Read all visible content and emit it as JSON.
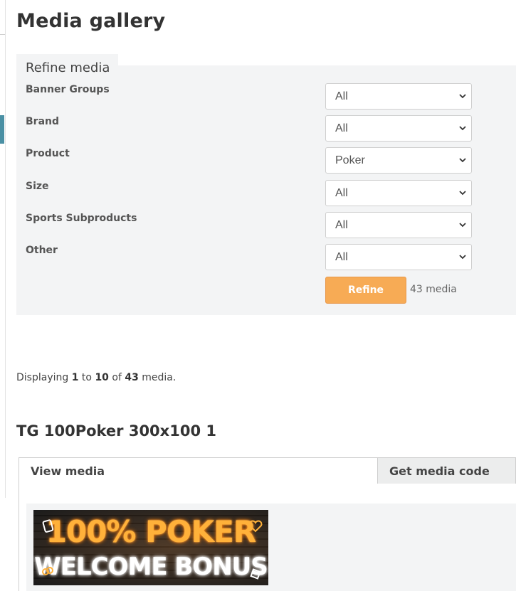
{
  "page": {
    "title": "Media gallery"
  },
  "refine": {
    "title": "Refine media",
    "filters": [
      {
        "label": "Banner Groups",
        "value": "All"
      },
      {
        "label": "Brand",
        "value": "All"
      },
      {
        "label": "Product",
        "value": "Poker"
      },
      {
        "label": "Size",
        "value": "All"
      },
      {
        "label": "Sports Subproducts",
        "value": "All"
      },
      {
        "label": "Other",
        "value": "All"
      }
    ],
    "button_label": "Refine",
    "count_text": "43 media"
  },
  "pagination": {
    "prefix": "Displaying",
    "from": "1",
    "to_word": "to",
    "to": "10",
    "of_word": "of",
    "total": "43",
    "suffix": "media."
  },
  "media_item": {
    "title": "TG 100Poker 300x100 1",
    "tabs": {
      "view": "View media",
      "code": "Get media code"
    },
    "banner": {
      "line1": "100% POKER",
      "line2": "WELCOME BONUS"
    }
  },
  "colors": {
    "accent_button": "#f7ab55",
    "panel_bg": "#f3f4f5",
    "side_accent": "#4a90a4",
    "banner_orange": "#ffb13a"
  },
  "icons": {
    "select_arrow": "chevron-down-icon",
    "banner_suits": [
      "spade-icon",
      "heart-icon",
      "diamond-icon"
    ]
  }
}
